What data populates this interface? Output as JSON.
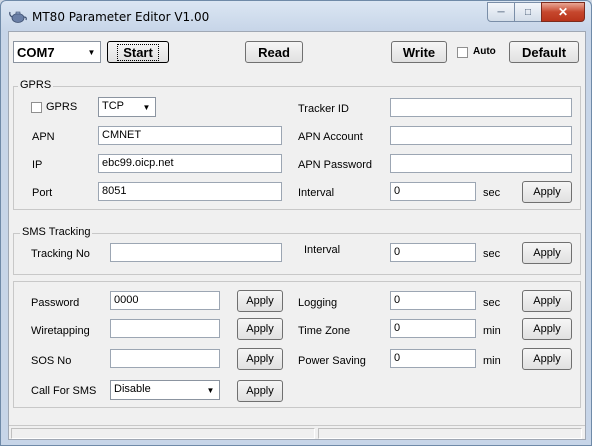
{
  "window": {
    "title": "MT80 Parameter Editor V1.00",
    "icon": "teapot-app-icon"
  },
  "toolbar": {
    "port_value": "COM7",
    "start_label": "Start",
    "read_label": "Read",
    "write_label": "Write",
    "auto_label": "Auto",
    "default_label": "Default"
  },
  "gprs": {
    "group_title": "GPRS",
    "enable_label": "GPRS",
    "protocol_value": "TCP",
    "apn_label": "APN",
    "apn_value": "CMNET",
    "ip_label": "IP",
    "ip_value": "ebc99.oicp.net",
    "port_label": "Port",
    "port_value": "8051",
    "tracker_id_label": "Tracker ID",
    "tracker_id_value": "",
    "apn_account_label": "APN Account",
    "apn_account_value": "",
    "apn_password_label": "APN Password",
    "apn_password_value": "",
    "interval_label": "Interval",
    "interval_value": "0",
    "interval_unit": "sec",
    "apply_label": "Apply"
  },
  "sms": {
    "group_title": "SMS  Tracking",
    "tracking_no_label": "Tracking No",
    "tracking_no_value": "",
    "interval_label": "Interval",
    "interval_value": "0",
    "interval_unit": "sec",
    "apply_label": "Apply"
  },
  "settings": {
    "password_label": "Password",
    "password_value": "0000",
    "wiretapping_label": "Wiretapping",
    "wiretapping_value": "",
    "sos_label": "SOS No",
    "sos_value": "",
    "callsms_label": "Call For SMS",
    "callsms_value": "Disable",
    "logging_label": "Logging",
    "logging_value": "0",
    "logging_unit": "sec",
    "timezone_label": "Time Zone",
    "timezone_value": "0",
    "timezone_unit": "min",
    "powersaving_label": "Power Saving",
    "powersaving_value": "0",
    "powersaving_unit": "min",
    "apply_label": "Apply"
  }
}
